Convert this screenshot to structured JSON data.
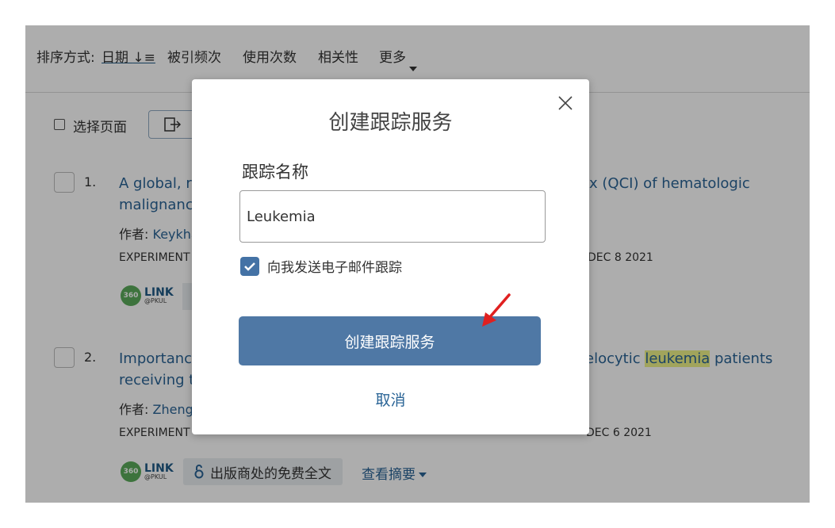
{
  "sortbar": {
    "label": "排序方式:",
    "date": "日期",
    "date_icon": "sort-desc-icon",
    "cited": "被引频次",
    "usage": "使用次数",
    "relevance": "相关性",
    "more": "更多"
  },
  "toolbar": {
    "select_page": "选择页面"
  },
  "results": [
    {
      "num": "1.",
      "title_line1_left": "A global, reg",
      "title_line1_right": "x (QCI) of hematologic",
      "title_line2_left": "malignancie",
      "authors_label": "作者:",
      "authors": "Keykha",
      "source_left": "EXPERIMENT",
      "source_right": "DEC 8 2021"
    },
    {
      "num": "2.",
      "title_line1_left": "Importance",
      "title_line1_right_pre": "elocytic ",
      "title_line1_highlight": "leukemia",
      "title_line1_right_post": " patients",
      "title_line2_left": "receiving th",
      "authors_label": "作者:",
      "authors": "Zheng,",
      "source_left": "EXPERIMENT",
      "source_right": "DEC 6 2021",
      "oa_label": "出版商处的免费全文",
      "abstract_label": "查看摘要"
    }
  ],
  "linklogo": {
    "circle": "360",
    "big": "LINK",
    "small": "@PKUL"
  },
  "modal": {
    "title": "创建跟踪服务",
    "field_label": "跟踪名称",
    "input_value": "Leukemia",
    "checkbox_label": "向我发送电子邮件跟踪",
    "checkbox_checked": true,
    "primary_button": "创建跟踪服务",
    "cancel": "取消"
  },
  "colors": {
    "accent": "#4f78a5",
    "link": "#2a6496",
    "overlay": "rgba(0,0,0,0.32)",
    "arrow": "#e02020"
  }
}
